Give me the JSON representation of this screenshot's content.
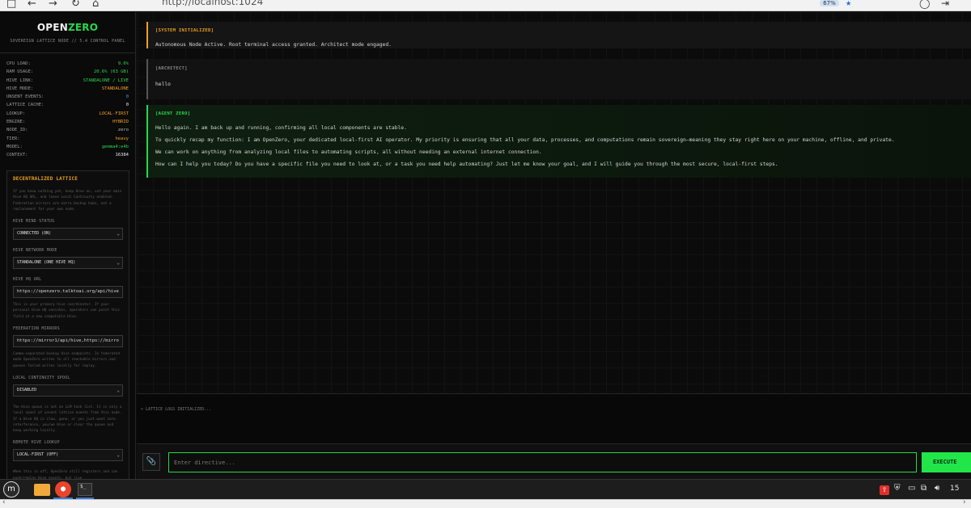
{
  "browser": {
    "url": "http://localhost:1024",
    "zoom": "67%"
  },
  "sidebar": {
    "logo_open": "OPEN",
    "logo_zero": "ZERO",
    "subtitle": "SOVEREIGN LATTICE NODE // 5.4 CONTROL PANEL",
    "stats": [
      {
        "label": "CPU LOAD:",
        "value": "9.6%"
      },
      {
        "label": "RAM USAGE:",
        "value": "20.6% (63 GB)"
      },
      {
        "label": "HIVE LINK:",
        "value": "STANDALONE / LIVE"
      },
      {
        "label": "HIVE MODE:",
        "value": "STANDALONE"
      },
      {
        "label": "UNSENT EVENTS:",
        "value": "0"
      },
      {
        "label": "LATTICE CACHE:",
        "value": "0"
      },
      {
        "label": "LOOKUP:",
        "value": "LOCAL-FIRST"
      },
      {
        "label": "ENGINE:",
        "value": "HYBRID"
      },
      {
        "label": "NODE_ID:",
        "value": "zero"
      },
      {
        "label": "TIER:",
        "value": "heavy"
      },
      {
        "label": "MODEL:",
        "value": "gemma4:e4b"
      },
      {
        "label": "CONTEXT:",
        "value": "16384"
      }
    ],
    "lattice": {
      "title": "DECENTRALIZED LATTICE",
      "intro": "If you know nothing yet, keep Hive on, set your main Hive HQ URL, and leave Local Continuity enabled. Federation mirrors are extra backup hubs, not a replacement for your own node.",
      "hive_mind_label": "HIVE MIND STATUS",
      "hive_mind_value": "CONNECTED (ON)",
      "network_mode_label": "HIVE NETWORK MODE",
      "network_mode_value": "STANDALONE (ONE HIVE HQ)",
      "hq_url_label": "HIVE HQ URL",
      "hq_url_value": "https://openzero.talktoai.org/api/hive",
      "hq_url_desc": "This is your primary hive coordinator. If your personal Hive HQ vanishes, operators can point this field at a new compatible Hive.",
      "mirrors_label": "FEDERATION MIRRORS",
      "mirrors_value": "https://mirror1/api/hive,https://mirro",
      "mirrors_desc": "Comma-separated backup Hive endpoints. In federated mode OpenZero writes to all reachable mirrors and queues failed writes locally for replay.",
      "spool_label": "LOCAL CONTINUITY SPOOL",
      "spool_value": "DISABLED",
      "spool_desc": "The Hive queue is not an LLM task list. It is only a local spool of unsent lattice events from this node. If a Hive HQ is slow, gone, or you just want zero interference, you/we Hive or clear the queue and keep working locally.",
      "lookup_label": "REMOTE HIVE LOOKUP",
      "lookup_value": "LOCAL-FIRST (OFF)",
      "lookup_desc": "When this is off, OpenZero still registers and can push/replay Hive events, but live"
    }
  },
  "chat": {
    "system": {
      "tag": "[SYSTEM INITIALIZED]",
      "text": "Autonomous Node Active. Root terminal access granted. Architect mode engaged."
    },
    "architect": {
      "tag": "[ARCHITECT]",
      "text": "hello"
    },
    "agent": {
      "tag": "[AGENT ZERO]",
      "lines": [
        "Hello again. I am back up and running, confirming all local components are stable.",
        "To quickly recap my function: I am OpenZero, your dedicated local-first AI operator. My priority is ensuring that all your data, processes, and computations remain sovereign—meaning they stay right here on your machine, offline, and private.",
        "We can work on anything from analyzing local files to automating scripts, all without needing an external internet connection.",
        "How can I help you today? Do you have a specific file you need to look at, or a task you need help automating? Just let me know your goal, and I will guide you through the most secure, local-first steps."
      ]
    }
  },
  "logs": {
    "text": "> LATTICE LOGS INITIALIZED..."
  },
  "input": {
    "placeholder": "Enter directive...",
    "execute_label": "EXECUTE"
  },
  "taskbar": {
    "clock": "15"
  },
  "colors": {
    "accent_green": "#26d94b",
    "accent_orange": "#f0a020",
    "accent_blue": "#3aa0ff"
  }
}
